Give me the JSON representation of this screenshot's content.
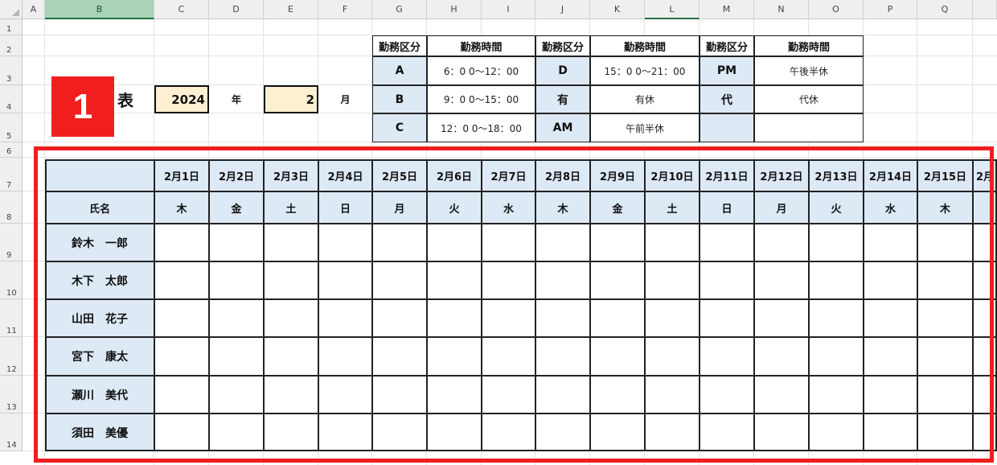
{
  "sheet": {
    "columns": [
      "A",
      "B",
      "C",
      "D",
      "E",
      "F",
      "G",
      "H",
      "I",
      "J",
      "K",
      "L",
      "M",
      "N",
      "O",
      "P",
      "Q"
    ],
    "selected_column": "B",
    "rows": [
      "1",
      "2",
      "3",
      "4",
      "5",
      "6",
      "7",
      "8",
      "9",
      "10",
      "11",
      "12",
      "13",
      "14"
    ]
  },
  "header": {
    "title_suffix": "表",
    "year_value": "2024",
    "year_unit": "年",
    "month_value": "2",
    "month_unit": "月"
  },
  "legend": {
    "headers": [
      "勤務区分",
      "勤務時間",
      "勤務区分",
      "勤務時間",
      "勤務区分",
      "勤務時間"
    ],
    "rows": [
      [
        {
          "code": "A",
          "time": "6：0 0〜12：00"
        },
        {
          "code": "D",
          "time": "15：0 0〜21：00"
        },
        {
          "code": "PM",
          "time": "午後半休"
        }
      ],
      [
        {
          "code": "B",
          "time": "9：0 0〜15：00"
        },
        {
          "code": "有",
          "time": "有休"
        },
        {
          "code": "代",
          "time": "代休"
        }
      ],
      [
        {
          "code": "C",
          "time": "12：0 0〜18：00"
        },
        {
          "code": "AM",
          "time": "午前半休"
        },
        {
          "code": "",
          "time": ""
        }
      ]
    ]
  },
  "schedule": {
    "name_header": "氏名",
    "dates": [
      "2月1日",
      "2月2日",
      "2月3日",
      "2月4日",
      "2月5日",
      "2月6日",
      "2月7日",
      "2月8日",
      "2月9日",
      "2月10日",
      "2月11日",
      "2月12日",
      "2月13日",
      "2月14日",
      "2月15日",
      "2月"
    ],
    "weekdays": [
      "木",
      "金",
      "土",
      "日",
      "月",
      "火",
      "水",
      "木",
      "金",
      "土",
      "日",
      "月",
      "火",
      "水",
      "木",
      ""
    ],
    "names": [
      "鈴木　一郎",
      "木下　太郎",
      "山田　花子",
      "宮下　康太",
      "瀬川　美代",
      "須田　美優"
    ]
  },
  "annotation": {
    "badge": "1",
    "highlight_color": "#f01e1e"
  }
}
